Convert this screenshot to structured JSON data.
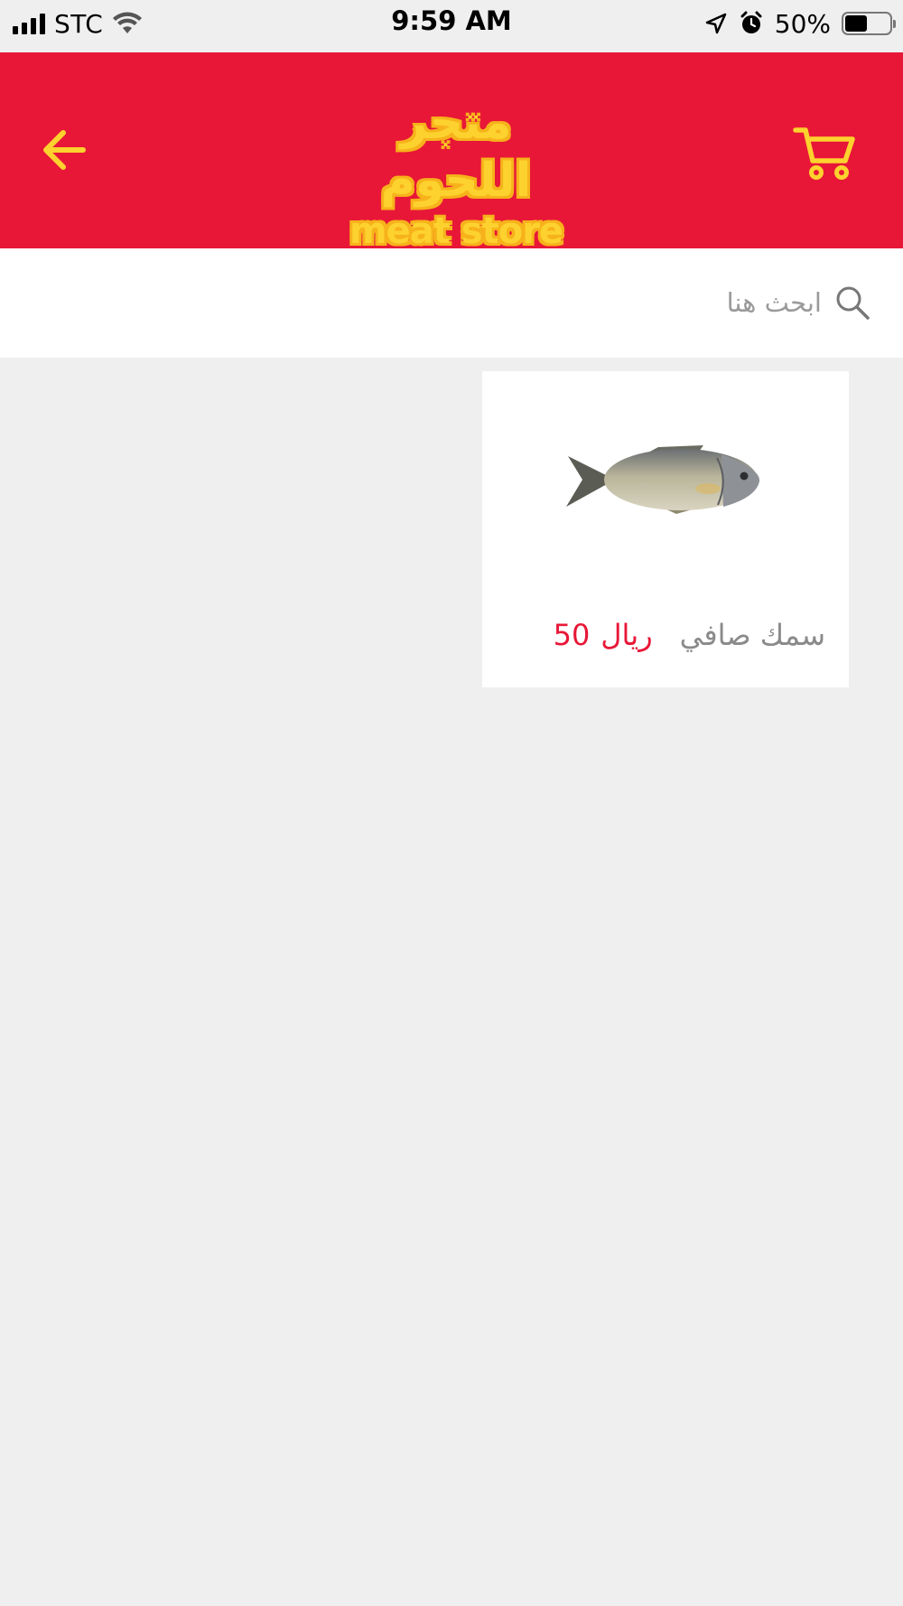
{
  "status_bar": {
    "carrier": "STC",
    "time": "9:59 AM",
    "battery_percent": "50%",
    "battery_level": 0.5,
    "icons": [
      "signal-icon",
      "wifi-icon",
      "location-icon",
      "alarm-icon",
      "battery-icon"
    ]
  },
  "header": {
    "logo_arabic": "متجر اللحوم",
    "logo_english": "meat store",
    "background_color": "#e81737",
    "accent_color": "#fdd22e",
    "back_icon": "arrow-left-icon",
    "cart_icon": "cart-icon"
  },
  "search": {
    "placeholder": "ابحث هنا",
    "value": "",
    "icon": "search-icon"
  },
  "products": [
    {
      "name": "سمك صافي",
      "price_value": "50",
      "price_currency": "ريال",
      "image": "fish-image"
    }
  ]
}
